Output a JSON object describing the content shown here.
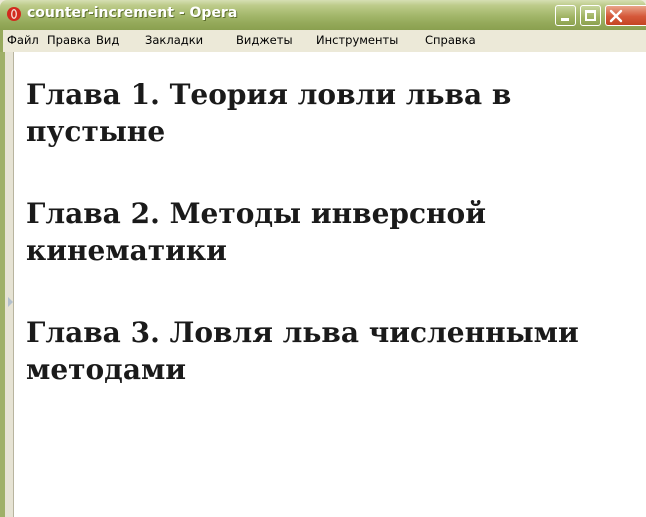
{
  "window": {
    "title": "counter-increment - Opera",
    "accent": "#a4b86c",
    "app_icon": "opera-icon"
  },
  "menu": {
    "items": [
      {
        "label": "Файл"
      },
      {
        "label": "Правка"
      },
      {
        "label": "Вид"
      },
      {
        "label": "Закладки"
      },
      {
        "label": "Виджеты"
      },
      {
        "label": "Инструменты"
      },
      {
        "label": "Справка"
      }
    ]
  },
  "content": {
    "chapters": [
      {
        "prefix": "Глава",
        "number": "1",
        "title": "Теория ловли льва в пустыне"
      },
      {
        "prefix": "Глава",
        "number": "2",
        "title": "Методы инверсной кинематики"
      },
      {
        "prefix": "Глава",
        "number": "3",
        "title": "Ловля льва численными методами"
      }
    ]
  }
}
